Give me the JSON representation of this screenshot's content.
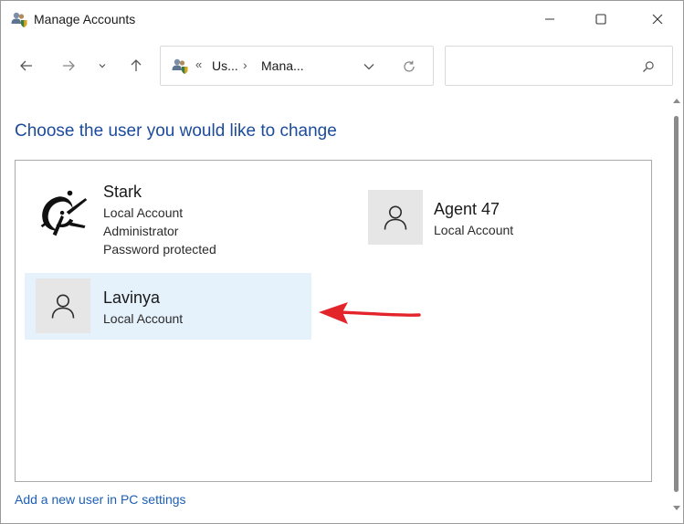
{
  "window": {
    "title": "Manage Accounts",
    "icon": "users-shield-icon"
  },
  "controls": {
    "minimize_icon": "minimize-icon",
    "maximize_icon": "maximize-icon",
    "close_icon": "close-icon"
  },
  "nav": {
    "back_icon": "arrow-left-icon",
    "forward_icon": "arrow-right-icon",
    "recent_icon": "chevron-down-icon",
    "up_icon": "arrow-up-icon"
  },
  "address": {
    "overflow": "«",
    "segment1": "Us...",
    "separator": "›",
    "segment2": "Mana...",
    "dropdown_icon": "chevron-down-icon",
    "refresh_icon": "refresh-icon"
  },
  "search": {
    "value": "",
    "icon": "search-icon"
  },
  "main": {
    "heading": "Choose the user you would like to change",
    "add_user_link": "Add a new user in PC settings"
  },
  "accounts": [
    {
      "name": "Stark",
      "lines": [
        "Local Account",
        "Administrator",
        "Password protected"
      ],
      "avatar": "custom-logo"
    },
    {
      "name": "Agent 47",
      "lines": [
        "Local Account"
      ],
      "avatar": "person-icon"
    },
    {
      "name": "Lavinya",
      "lines": [
        "Local Account"
      ],
      "avatar": "person-icon",
      "selected": true
    }
  ],
  "colors": {
    "heading": "#1c4b9c",
    "link": "#1c5fb5",
    "selection": "#e5f1fb",
    "annotation_arrow": "#e3242b"
  }
}
